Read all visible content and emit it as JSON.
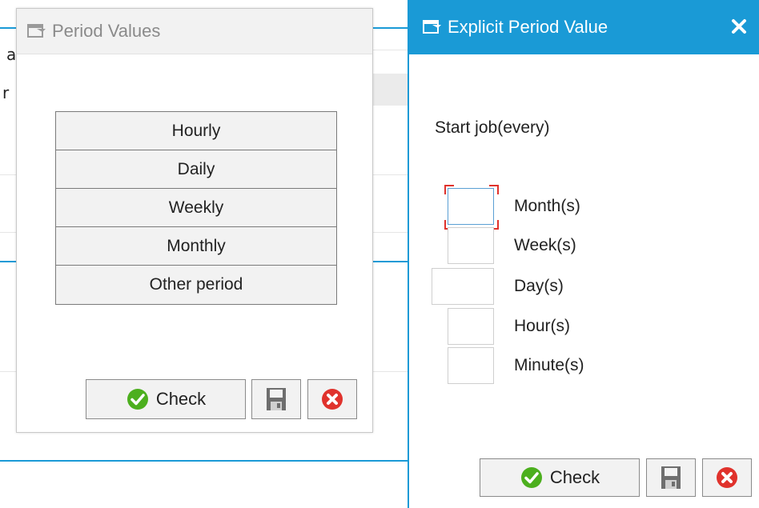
{
  "background": {
    "fragment_1": "a",
    "fragment_2": "r"
  },
  "period_values_dialog": {
    "title": "Period Values",
    "icon": "dialog-window-icon",
    "options": [
      {
        "label": "Hourly"
      },
      {
        "label": "Daily"
      },
      {
        "label": "Weekly"
      },
      {
        "label": "Monthly"
      },
      {
        "label": "Other period"
      }
    ],
    "check_label": "Check",
    "save_icon": "save-icon",
    "cancel_icon": "cancel-icon"
  },
  "explicit_period_dialog": {
    "title": "Explicit Period Value",
    "icon": "dialog-window-icon",
    "close_icon": "close-icon",
    "start_label": "Start job(every)",
    "units": [
      {
        "label": "Month(s)",
        "value": ""
      },
      {
        "label": "Week(s)",
        "value": ""
      },
      {
        "label": "Day(s)",
        "value": ""
      },
      {
        "label": "Hour(s)",
        "value": ""
      },
      {
        "label": "Minute(s)",
        "value": ""
      }
    ],
    "check_label": "Check",
    "save_icon": "save-icon",
    "cancel_icon": "cancel-icon"
  },
  "colors": {
    "accent": "#1a9ad6",
    "check_green": "#4caf1e",
    "cancel_red": "#e0322c"
  }
}
